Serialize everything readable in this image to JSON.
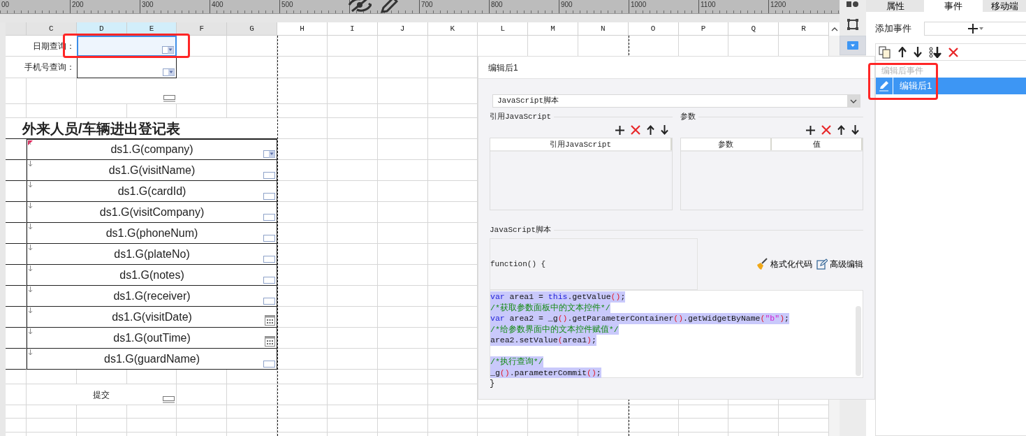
{
  "ruler": {
    "labels": [
      "00",
      "200",
      "300",
      "400",
      "500",
      "700",
      "800",
      "900",
      "1000",
      "1100",
      "1200"
    ]
  },
  "columns": [
    {
      "label": "C",
      "selected": false,
      "in_print_area": true
    },
    {
      "label": "D",
      "selected": true,
      "in_print_area": true
    },
    {
      "label": "E",
      "selected": true,
      "in_print_area": true
    },
    {
      "label": "F",
      "selected": false,
      "in_print_area": true
    },
    {
      "label": "G",
      "selected": false,
      "in_print_area": true
    },
    {
      "label": "H",
      "selected": false,
      "in_print_area": false
    },
    {
      "label": "I",
      "selected": false,
      "in_print_area": false
    },
    {
      "label": "J",
      "selected": false,
      "in_print_area": false
    },
    {
      "label": "K",
      "selected": false,
      "in_print_area": false
    },
    {
      "label": "L",
      "selected": false,
      "in_print_area": false
    },
    {
      "label": "M",
      "selected": false,
      "in_print_area": false
    },
    {
      "label": "N",
      "selected": false,
      "in_print_area": false
    },
    {
      "label": "O",
      "selected": false,
      "in_print_area": false
    },
    {
      "label": "P",
      "selected": false,
      "in_print_area": false
    },
    {
      "label": "Q",
      "selected": false,
      "in_print_area": false
    },
    {
      "label": "R",
      "selected": false,
      "in_print_area": false
    }
  ],
  "params": [
    {
      "label": "日期查询：",
      "selected": true,
      "kind": "combo"
    },
    {
      "label": "手机号查询：",
      "selected": false,
      "kind": "combo"
    }
  ],
  "title": "外来人员/车辆进出登记表",
  "rows": [
    {
      "formula": "ds1.G(company)",
      "kind": "combo",
      "flagged": true
    },
    {
      "formula": "ds1.G(visitName)",
      "kind": "text",
      "flagged": false
    },
    {
      "formula": "ds1.G(cardId)",
      "kind": "text",
      "flagged": false
    },
    {
      "formula": "ds1.G(visitCompany)",
      "kind": "text",
      "flagged": false
    },
    {
      "formula": "ds1.G(phoneNum)",
      "kind": "text",
      "flagged": false
    },
    {
      "formula": "ds1.G(plateNo)",
      "kind": "text",
      "flagged": false
    },
    {
      "formula": "ds1.G(notes)",
      "kind": "text",
      "flagged": false
    },
    {
      "formula": "ds1.G(receiver)",
      "kind": "text",
      "flagged": false
    },
    {
      "formula": "ds1.G(visitDate)",
      "kind": "date",
      "flagged": false
    },
    {
      "formula": "ds1.G(outTime)",
      "kind": "date",
      "flagged": false
    },
    {
      "formula": "ds1.G(guardName)",
      "kind": "text",
      "flagged": false
    }
  ],
  "submit": "提交",
  "toolbar": [
    {
      "kind": "mark",
      "selected": false
    },
    {
      "kind": "frame",
      "selected": false
    },
    {
      "kind": "combo",
      "selected": true
    }
  ],
  "dialog": {
    "title": "编辑后1",
    "type_select": "JavaScript脚本",
    "imports": {
      "legend": "引用JavaScript",
      "columns": [
        "引用JavaScript"
      ]
    },
    "params": {
      "legend": "参数",
      "columns": [
        "参数",
        "值"
      ]
    },
    "script": {
      "legend": "JavaScript脚本",
      "header": "function() {",
      "actions": [
        "格式化代码",
        "高级编辑"
      ],
      "lines": [
        {
          "kind": "code",
          "selected": true,
          "tokens": [
            {
              "kind": "kw",
              "t": "var"
            },
            {
              "kind": "plain",
              "t": " area1 = "
            },
            {
              "kind": "kw",
              "t": "this"
            },
            {
              "kind": "plain",
              "t": ".getValue"
            },
            {
              "kind": "paren",
              "t": "()"
            },
            {
              "kind": "plain",
              "t": ";"
            }
          ]
        },
        {
          "kind": "code",
          "selected": true,
          "tokens": [
            {
              "kind": "comment",
              "t": "/*获取参数面板中的文本控件*/"
            }
          ]
        },
        {
          "kind": "code",
          "selected": true,
          "tokens": [
            {
              "kind": "kw",
              "t": "var"
            },
            {
              "kind": "plain",
              "t": " area2 = _g"
            },
            {
              "kind": "paren",
              "t": "()"
            },
            {
              "kind": "plain",
              "t": ".getParameterContainer"
            },
            {
              "kind": "paren",
              "t": "()"
            },
            {
              "kind": "plain",
              "t": ".getWidgetByName"
            },
            {
              "kind": "paren",
              "t": "("
            },
            {
              "kind": "string",
              "t": "\"b\""
            },
            {
              "kind": "paren",
              "t": ")"
            },
            {
              "kind": "plain",
              "t": ";"
            }
          ]
        },
        {
          "kind": "code",
          "selected": true,
          "tokens": [
            {
              "kind": "comment",
              "t": "/*给参数界面中的文本控件赋值*/"
            }
          ]
        },
        {
          "kind": "code",
          "selected": true,
          "tokens": [
            {
              "kind": "plain",
              "t": "area2.setValue"
            },
            {
              "kind": "paren",
              "t": "("
            },
            {
              "kind": "plain",
              "t": "area1"
            },
            {
              "kind": "paren",
              "t": ")"
            },
            {
              "kind": "plain",
              "t": ";"
            }
          ]
        },
        {
          "kind": "blank",
          "selected": false
        },
        {
          "kind": "code",
          "selected": true,
          "tokens": [
            {
              "kind": "comment",
              "t": "/*执行查询*/"
            }
          ]
        },
        {
          "kind": "code",
          "selected": true,
          "tokens": [
            {
              "kind": "plain",
              "t": "_g"
            },
            {
              "kind": "paren",
              "t": "()"
            },
            {
              "kind": "plain",
              "t": ".parameterCommit"
            },
            {
              "kind": "paren",
              "t": "()"
            },
            {
              "kind": "plain",
              "t": ";"
            }
          ]
        }
      ],
      "footer": "}"
    }
  },
  "side_panel": {
    "tabs": [
      {
        "label": "属性",
        "selected": false
      },
      {
        "label": "事件",
        "selected": true
      },
      {
        "label": "移动端",
        "selected": false
      }
    ],
    "add_label": "添加事件",
    "events_header": "编辑后事件",
    "events": [
      {
        "label": "编辑后1",
        "selected": true
      }
    ]
  }
}
